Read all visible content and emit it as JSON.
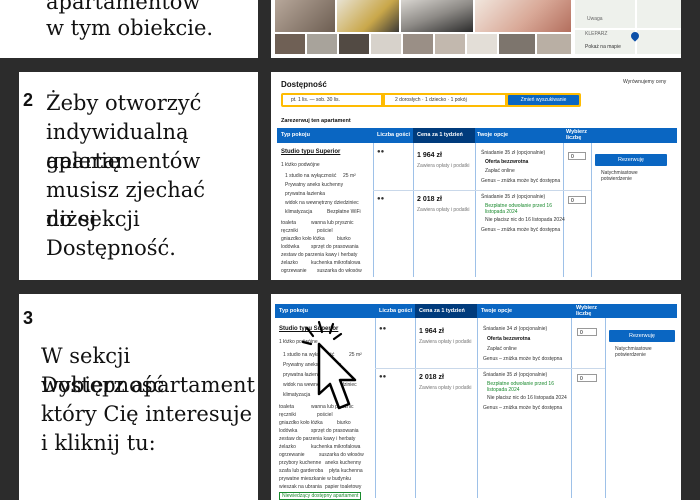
{
  "step1": {
    "text_lines": [
      "apartamentów",
      "w tym obiekcie."
    ],
    "map": {
      "label_top": "Uwaga",
      "label_left": "KLEPARZ",
      "label_bottom": "Pokaż na mapie"
    }
  },
  "step2": {
    "number": "2",
    "text_lines": [
      "Żeby otworzyć",
      "indywidualną galerię",
      "apartamentów",
      "musisz zjechać niżej",
      "do sekcji",
      "Dostępność."
    ],
    "screenshot": {
      "title": "Dostępność",
      "price_match": "Wyrównujemy ceny",
      "dates": "pt. 1 lis. — sob. 30 lis.",
      "guests": "2 dorosłych · 1 dziecko · 1 pokój",
      "search_btn": "Zmień wyszukiwanie",
      "reserve_label": "Zarezerwuj ten apartament",
      "headers": [
        "Typ pokoju",
        "Liczba gości",
        "Cena za 1 tydzień",
        "Twoje opcje",
        "Wybierz liczbę"
      ],
      "room_name": "Studio typu Superior",
      "room_bed": "1 łóżko podwójne",
      "features": [
        "1 studio na wyłączność",
        "25 m²",
        "Prywatny aneks kuchenny",
        "prywatna łazienka",
        "widok na wewnętrzny dziedziniec",
        "klimatyzacja",
        "Bezpłatne WiFi"
      ],
      "amenities": [
        "toaleta",
        "wanna lub prysznic",
        "ręczniki",
        "pościel",
        "gniazdko koło łóżka",
        "biurko",
        "lodówka",
        "sprzęt do prasowania",
        "zestaw do parzenia kawy i herbaty",
        "żelazko",
        "kuchenka mikrofalowa",
        "ogrzewanie",
        "suszarka do włosów"
      ],
      "price1": "1 964 zł",
      "price2": "2 018 zł",
      "price_note": "Zawiera opłaty i podatki",
      "options1": [
        "Śniadanie 35 zł (opcjonalnie)",
        "Oferta bezzwrotna",
        "Zapłać online",
        "Genus – zniżka może być dostępna"
      ],
      "options2": [
        "Śniadanie 35 zł (opcjonalnie)",
        "Bezpłatne odwołanie przed 16 listopada 2024",
        "Nie płacisz nic do 16 listopada 2024",
        "Genus – zniżka może być dostępna"
      ],
      "qty": "0",
      "reserve_btn": "Rezerwuję",
      "instant": "Natychmiastowe potwierdzenie"
    }
  },
  "step3": {
    "number": "3",
    "text_lines": [
      "W sekcji Dostępność",
      "wybierz apartament",
      "który Cię interesuje",
      "i kliknij tu:"
    ],
    "screenshot": {
      "headers": [
        "Typ pokoju",
        "Liczba gości",
        "Cena za 1 tydzień",
        "Twoje opcje",
        "Wybierz liczbę"
      ],
      "room_name": "Studio typu Superior",
      "room_bed": "1 łóżko podwójne",
      "features": [
        "1 studio na wyłączność",
        "25 m²",
        "Prywatny aneks kuchenny",
        "prywatna łazienka",
        "widok na wewnętrzny dziedziniec",
        "klimatyzacja"
      ],
      "amenities": [
        "toaleta",
        "wanna lub prysznic",
        "ręczniki",
        "pościel",
        "gniazdko koło łóżka",
        "biurko",
        "lodówka",
        "sprzęt do prasowania",
        "zestaw do parzenia kawy i herbaty",
        "żelazko",
        "kuchenka mikrofalowa",
        "ogrzewanie",
        "suszarka do włosów",
        "przybory kuchenne",
        "aneks kuchenny",
        "szafa lub garderoba",
        "płyta kuchenna",
        "prywatne mieszkanie w budynku",
        "wieszak na ubrania",
        "papier toaletowy"
      ],
      "price1": "1 964 zł",
      "price2": "2 018 zł",
      "price_note": "Zawiera opłaty i podatki",
      "options1": [
        "Śniadanie 34 zł (opcjonalnie)",
        "Oferta bezzwrotna",
        "Zapłać online",
        "Genus – zniżka może być dostępna"
      ],
      "options2": [
        "Śniadanie 35 zł (opcjonalnie)",
        "Bezpłatne odwołanie przed 16 listopada 2024",
        "Nie płacisz nic do 16 listopada 2024",
        "Genus – zniżka może być dostępna"
      ],
      "qty": "0",
      "reserve_btn": "Rezerwuję",
      "instant": "Natychmiastowe potwierdzenie",
      "footer": "Niewiedzący dostępny apartament"
    }
  }
}
